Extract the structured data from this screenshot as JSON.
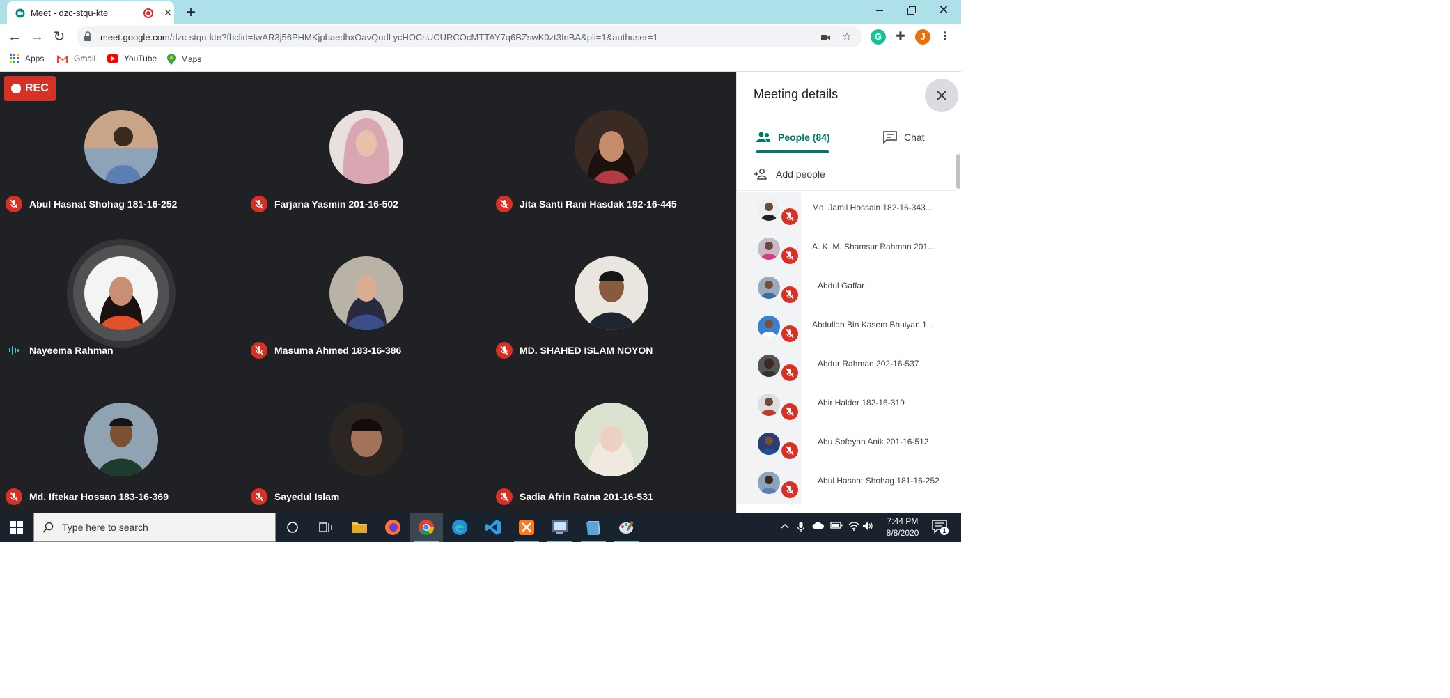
{
  "browser": {
    "tab_title": "Meet - dzc-stqu-kte",
    "url_host": "meet.google.com",
    "url_path": "/dzc-stqu-kte?fbclid=IwAR3j56PHMKjpbaedhxOavQudLycHOCsUCURCOcMTTAY7q6BZswK0zt3InBA&pli=1&authuser=1",
    "profile_initial": "J",
    "bookmarks": [
      "Apps",
      "Gmail",
      "YouTube",
      "Maps"
    ]
  },
  "meet": {
    "rec_label": "REC",
    "tiles": [
      {
        "name": "Abul Hasnat Shohag 181-16-252",
        "mic": "muted"
      },
      {
        "name": "Farjana Yasmin 201-16-502",
        "mic": "muted"
      },
      {
        "name": "Jita Santi Rani Hasdak 192-16-445",
        "mic": "muted"
      },
      {
        "name": "Nayeema Rahman",
        "mic": "speaking"
      },
      {
        "name": "Masuma Ahmed 183-16-386",
        "mic": "muted"
      },
      {
        "name": "MD. SHAHED ISLAM NOYON",
        "mic": "muted"
      },
      {
        "name": "Md. Iftekar Hossan 183-16-369",
        "mic": "muted"
      },
      {
        "name": "Sayedul Islam",
        "mic": "muted"
      },
      {
        "name": "Sadia Afrin Ratna 201-16-531",
        "mic": "muted"
      }
    ]
  },
  "panel": {
    "title": "Meeting details",
    "tab_people": "People (84)",
    "tab_chat": "Chat",
    "add_people": "Add people",
    "people": [
      {
        "name": "Md. Jamil Hossain 182-16-343..."
      },
      {
        "name": "A. K. M. Shamsur Rahman 201..."
      },
      {
        "name": "Abdul Gaffar"
      },
      {
        "name": "Abdullah Bin Kasem Bhuiyan 1..."
      },
      {
        "name": "Abdur Rahman 202-16-537"
      },
      {
        "name": "Abir Halder 182-16-319"
      },
      {
        "name": "Abu Sofeyan Anik 201-16-512"
      },
      {
        "name": "Abul Hasnat Shohag 181-16-252"
      }
    ]
  },
  "taskbar": {
    "search_placeholder": "Type here to search",
    "time": "7:44 PM",
    "date": "8/8/2020",
    "notification_count": "1"
  }
}
